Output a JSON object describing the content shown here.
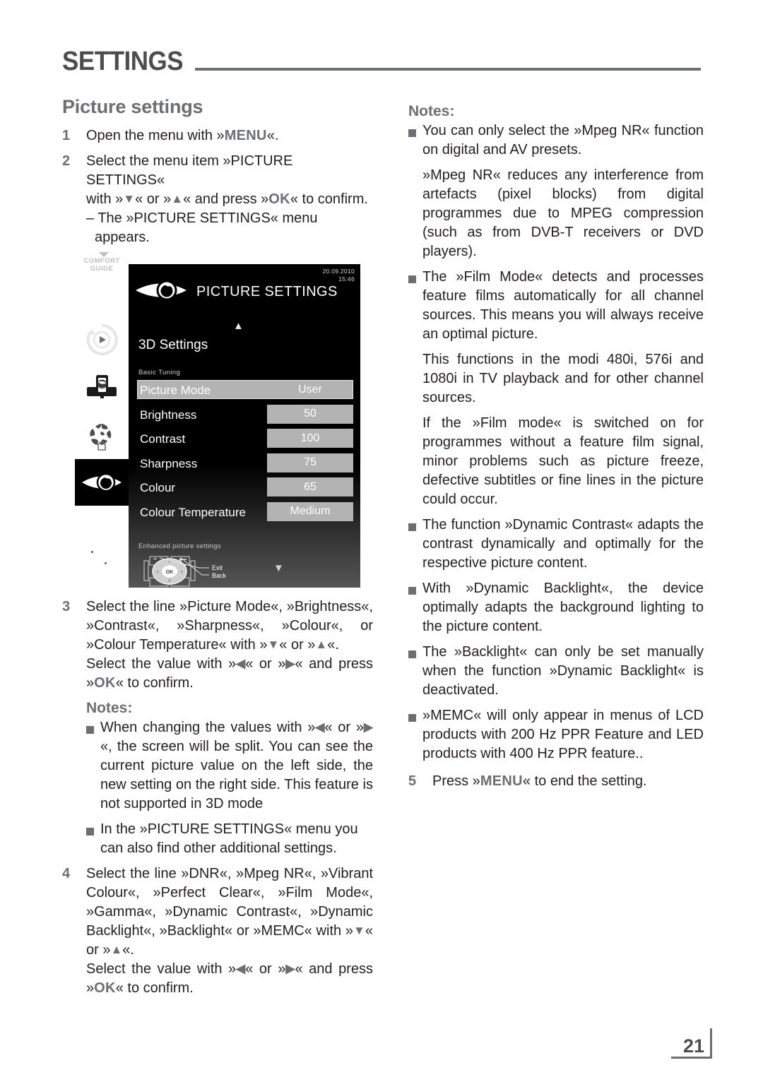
{
  "header": {
    "title": "SETTINGS"
  },
  "left_column": {
    "section_title": "Picture settings",
    "step1": {
      "num": "1",
      "text_a": "Open the menu with »",
      "key": "MENU",
      "text_b": "«."
    },
    "step2": {
      "num": "2",
      "line1": "Select the menu item »PICTURE SETTINGS«",
      "line2_a": "with »",
      "arrow_down": "▼",
      "line2_b": "« or »",
      "arrow_up": "▲",
      "line2_c": "« and press »",
      "key_ok": "OK",
      "line2_d": "« to confirm.",
      "line3": "– The »PICTURE SETTINGS« menu appears."
    },
    "step3": {
      "num": "3",
      "line1": "Select the line »Picture Mode«, »Brightness«, »Contrast«, »Sharpness«, »Colour«, or »Colour Temperature« with »",
      "arrow_down": "▼",
      "line1_b": "« or »",
      "arrow_up": "▲",
      "line1_c": "«.",
      "line2_a": "Select the value with »",
      "arrow_left": "◀",
      "line2_b": "« or »",
      "arrow_right": "▶",
      "line2_c": "« and press »",
      "key_ok": "OK",
      "line2_d": "« to confirm."
    },
    "notes_head": "Notes:",
    "note1": {
      "a": "When changing the values with »",
      "arrow_left": "◀",
      "b": "« or »",
      "arrow_right": "▶",
      "c": "«, the screen will be split. You can see the current picture value on the left side, the new setting on the right side. This feature is not supported in 3D mode"
    },
    "note2": {
      "text": "In the »PICTURE SETTINGS« menu you can also find other additional settings."
    },
    "step4": {
      "num": "4",
      "line1": "Select the line »DNR«, »Mpeg NR«, »Vibrant Colour«, »Perfect Clear«, »Film Mode«, »Gamma«, »Dynamic Contrast«, »Dynamic Backlight«, »Backlight« or »MEMC« with »",
      "arrow_down": "▼",
      "line1_b": "« or »",
      "arrow_up": "▲",
      "line1_c": "«.",
      "line2_a": "Select the value with »",
      "arrow_left": "◀",
      "line2_b": "« or »",
      "arrow_right": "▶",
      "line2_c": "« and press »",
      "key_ok": "OK",
      "line2_d": "« to confirm."
    }
  },
  "tv_menu": {
    "rail": {
      "comfort_line1": "COMFORT",
      "comfort_line2": "GUIDE"
    },
    "date": "20.09.2010",
    "time": "15:46",
    "title": "PICTURE SETTINGS",
    "submenu_3d": "3D Settings",
    "group_label": "Basic Tuning",
    "rows": [
      {
        "label": "Picture Mode",
        "value": "User",
        "selected": true
      },
      {
        "label": "Brightness",
        "value": "50",
        "selected": false
      },
      {
        "label": "Contrast",
        "value": "100",
        "selected": false
      },
      {
        "label": "Sharpness",
        "value": "75",
        "selected": false
      },
      {
        "label": "Colour",
        "value": "65",
        "selected": false
      },
      {
        "label": "Colour Temperature",
        "value": "Medium",
        "selected": false
      }
    ],
    "footer_label": "Enhanced picture settings",
    "navpad": {
      "ok": "OK",
      "exit": "Exit",
      "back": "Back"
    }
  },
  "right_column": {
    "notes_head": "Notes:",
    "note1": {
      "p1": "You can only select the »Mpeg NR« function on digital and AV presets.",
      "p2": "»Mpeg NR«  reduces any interference from artefacts (pixel blocks) from digital programmes due to MPEG compression (such as from DVB-T receivers or DVD players)."
    },
    "note2": {
      "p1": "The »Film Mode« detects and processes feature films automatically for all channel sources. This means you will always receive an optimal picture.",
      "p2": "This functions in the modi 480i, 576i and 1080i in TV playback and for other channel sources.",
      "p3": "If the »Film mode« is switched on for programmes without a feature film signal, minor problems such as picture freeze, defective subtitles or fine lines in the picture could occur."
    },
    "note3": {
      "p1": "The function »Dynamic Contrast« adapts the contrast dynamically and optimally for the respective picture content."
    },
    "note4": {
      "p1": "With »Dynamic Backlight«, the device optimally adapts the background lighting to the picture content."
    },
    "note5": {
      "p1": "The »Backlight« can only be set manually when the function »Dynamic Backlight« is deactivated."
    },
    "note6": {
      "p1": "»MEMC« will only appear in menus of LCD products with 200 Hz PPR Feature and LED products with 400 Hz PPR feature.."
    },
    "step5": {
      "num": "5",
      "a": "Press »",
      "key": "MENU",
      "b": "« to end the setting."
    }
  },
  "footer": {
    "page_number": "21"
  }
}
